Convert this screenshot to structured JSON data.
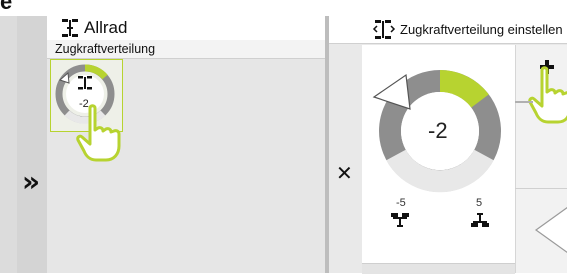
{
  "crop_letter": "e",
  "left_panel": {
    "title": "Allrad",
    "subtitle": "Zugkraftverteilung",
    "tile_value": "-2",
    "expand_icon": "double-chevron-right-icon"
  },
  "right_panel": {
    "title": "Zugkraftverteilung einstellen",
    "value": "-2",
    "min_label": "-5",
    "max_label": "5",
    "close_icon": "close-x-icon",
    "plus_icon": "plus-icon"
  },
  "colors": {
    "accent": "#b7d330",
    "dark_gray": "#8e8e8e",
    "light_gray": "#e8e8e8"
  },
  "gauge": {
    "min": -5,
    "max": 5,
    "value": -2
  }
}
